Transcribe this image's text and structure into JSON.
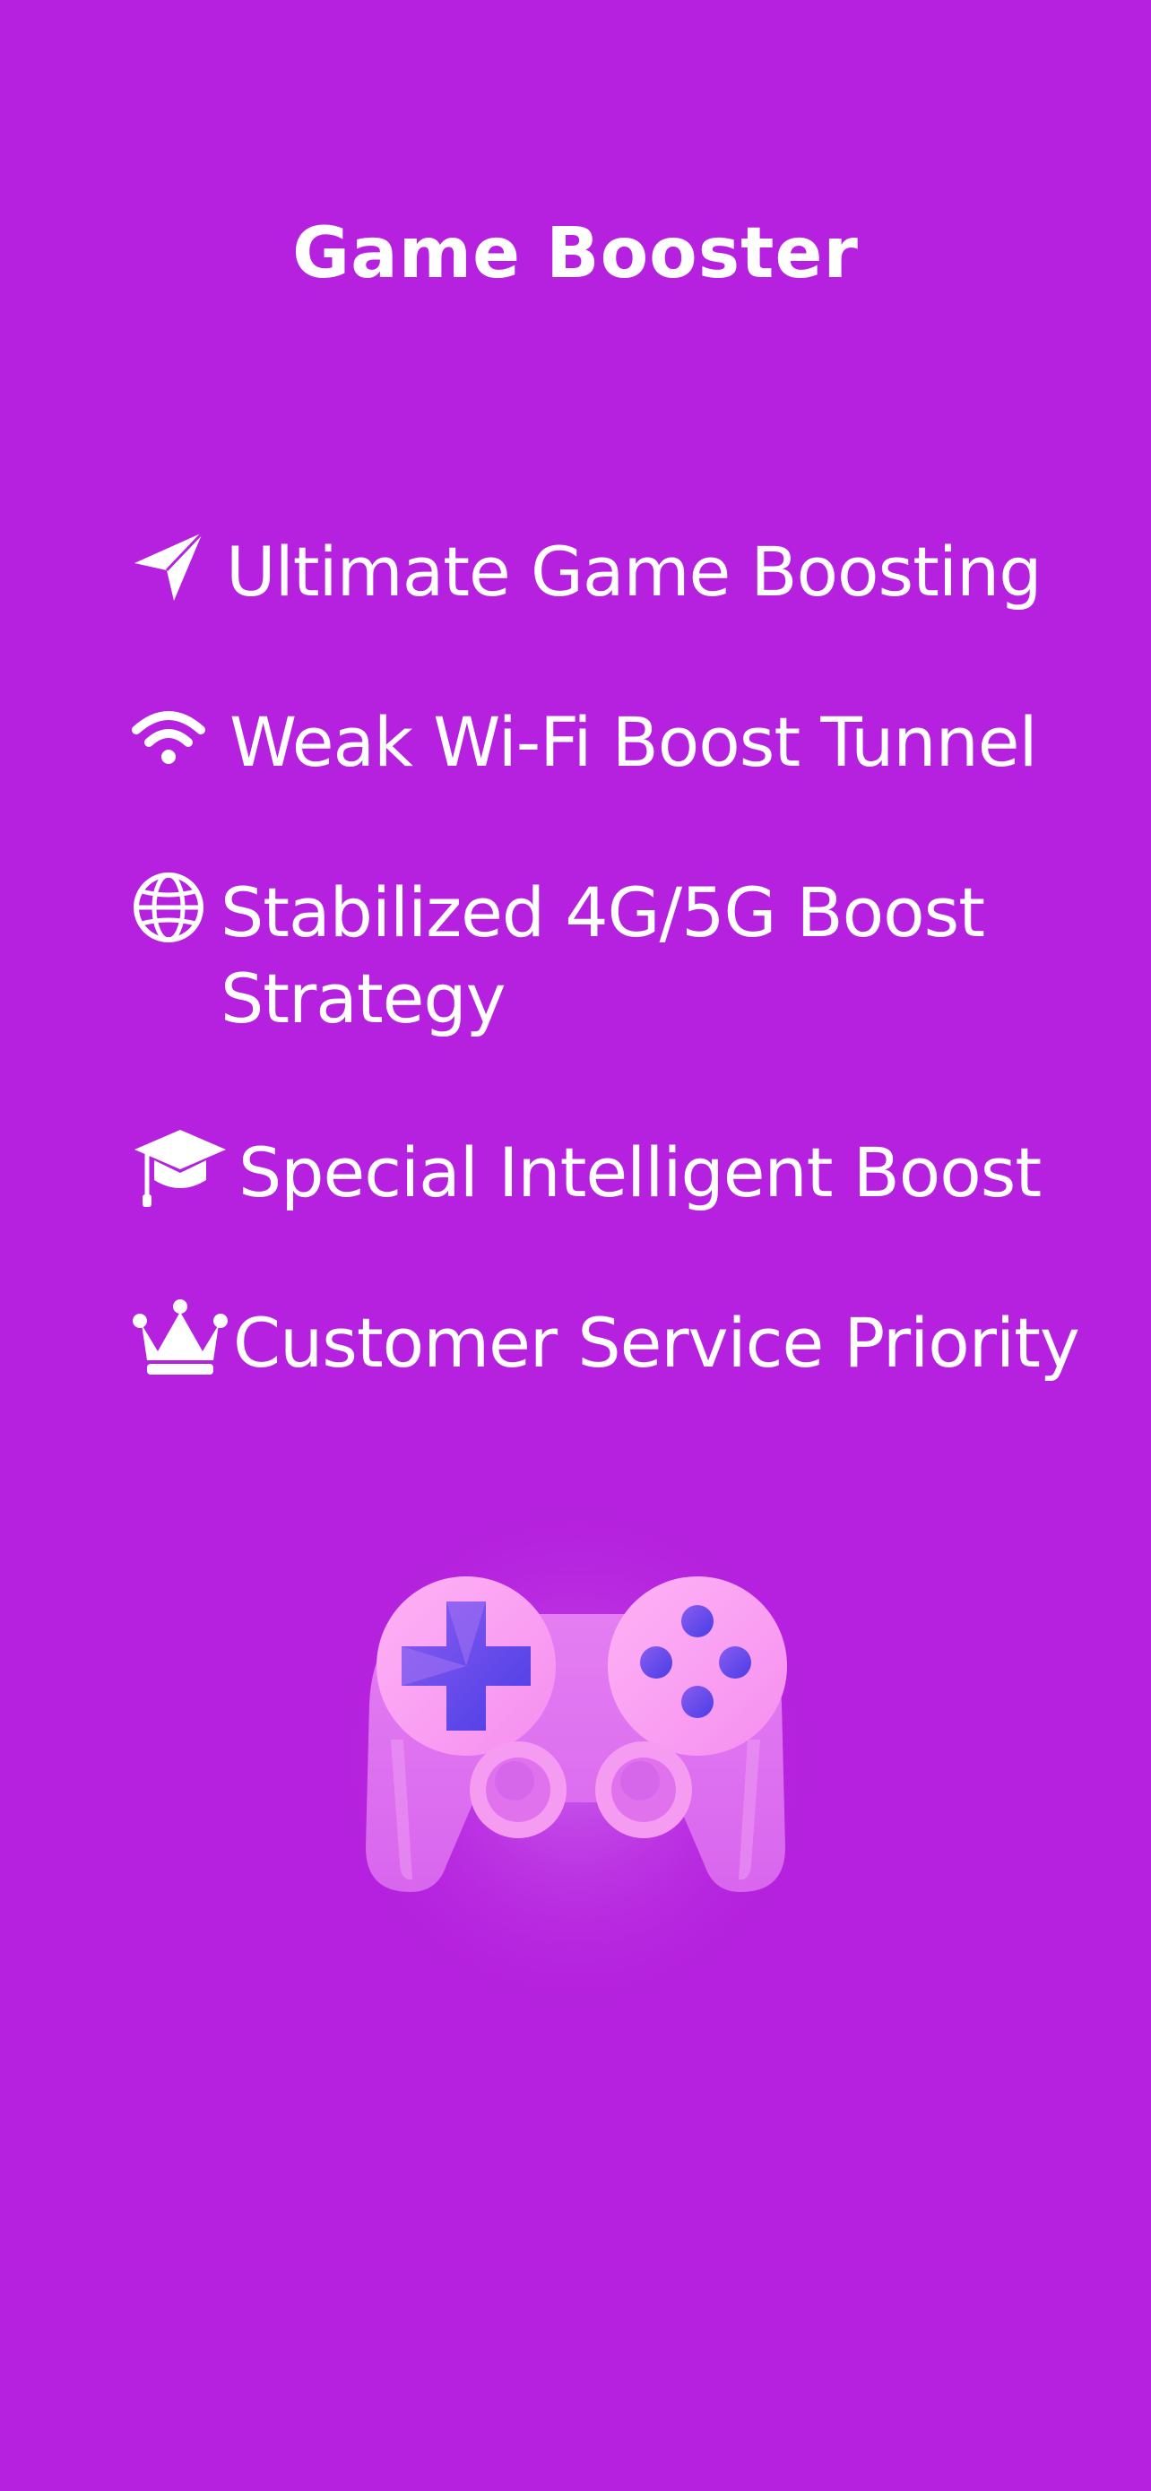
{
  "page": {
    "title": "Game Booster"
  },
  "features": [
    {
      "icon": "paper-plane-icon",
      "label": "Ultimate Game Boosting"
    },
    {
      "icon": "wifi-icon",
      "label": "Weak Wi-Fi Boost Tunnel"
    },
    {
      "icon": "globe-icon",
      "label": "Stabilized 4G/5G Boost Strategy"
    },
    {
      "icon": "graduation-cap-icon",
      "label": "Special Intelligent Boost"
    },
    {
      "icon": "crown-icon",
      "label": "Customer Service Priority"
    }
  ],
  "illustration": {
    "icon": "gamepad-icon"
  },
  "colors": {
    "background": "#b521de",
    "text": "#ffffff",
    "controller_body": "#e06ef0",
    "controller_light": "#ff9ff5",
    "controller_accent": "#5b3be8"
  }
}
